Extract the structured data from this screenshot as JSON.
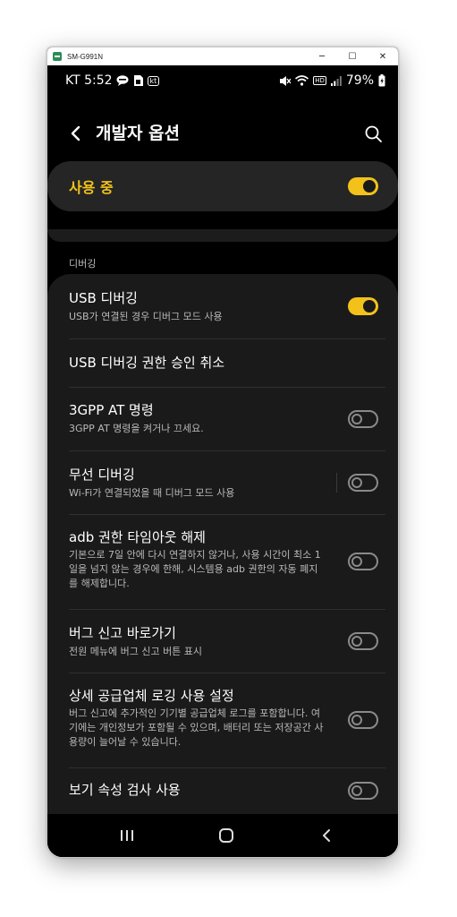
{
  "window": {
    "title": "SM-G991N",
    "minimize": "─",
    "maximize": "☐",
    "close": "✕"
  },
  "status_bar": {
    "carrier_time": "KT 5:52",
    "battery": "79%",
    "kt_badge": "kt",
    "hd_badge": "HD"
  },
  "app_bar": {
    "title": "개발자 옵션"
  },
  "master_switch": {
    "label": "사용 중",
    "on": true
  },
  "section": {
    "title": "디버깅"
  },
  "items": [
    {
      "title": "USB 디버깅",
      "subtitle": "USB가 연결된 경우 디버그 모드 사용",
      "toggle": true
    },
    {
      "title": "USB 디버깅 권한 승인 취소"
    },
    {
      "title": "3GPP AT 명령",
      "subtitle": "3GPP AT 명령을 켜거나 끄세요.",
      "toggle": false
    },
    {
      "title": "무선 디버깅",
      "subtitle": "Wi-Fi가 연결되었을 때 디버그 모드 사용",
      "toggle": false
    },
    {
      "title": "adb 권한 타임아웃 해제",
      "subtitle": "기본으로 7일 안에 다시 연결하지 않거나, 사용 시간이 최소 1일을 넘지 않는 경우에 한해, 시스템용 adb 권한의 자동 폐지를 해제합니다.",
      "toggle": false
    },
    {
      "title": "버그 신고 바로가기",
      "subtitle": "전원 메뉴에 버그 신고 버튼 표시",
      "toggle": false
    },
    {
      "title": "상세 공급업체 로깅 사용 설정",
      "subtitle": "버그 신고에 추가적인 기기별 공급업체 로그를 포함합니다. 여기에는 개인정보가 포함될 수 있으며, 배터리 또는 저장공간 사용량이 늘어날 수 있습니다.",
      "toggle": false
    },
    {
      "title": "보기 속성 검사 사용",
      "toggle": false
    }
  ],
  "nav_bar": {
    "recents": "recents-icon",
    "home": "home-icon",
    "back": "back-icon"
  },
  "colors": {
    "accent": "#f2c21b",
    "background": "#000000",
    "card": "#1a1a1a"
  }
}
